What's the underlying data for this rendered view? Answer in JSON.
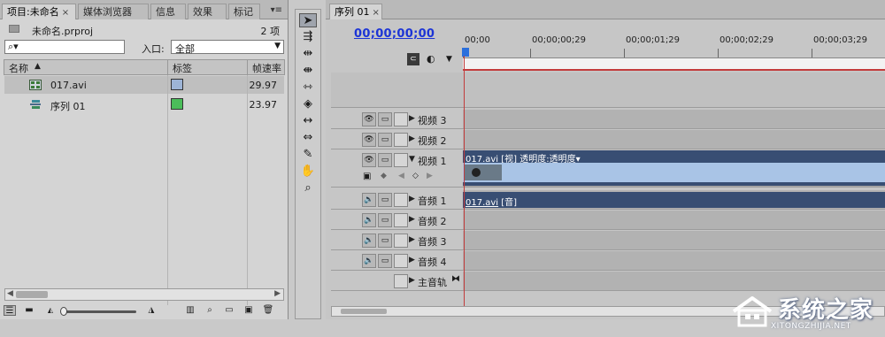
{
  "project_panel": {
    "tabs": [
      {
        "label": "项目:未命名",
        "close": "×"
      },
      {
        "label": "媒体浏览器"
      },
      {
        "label": "信息"
      },
      {
        "label": "效果"
      },
      {
        "label": "标记"
      }
    ],
    "menu_glyph": "▾≡",
    "project_file": "未命名.prproj",
    "item_count": "2 项",
    "search_placeholder": "",
    "search_glyph": "⌕▾",
    "entry_label": "入口:",
    "entry_value": "全部",
    "columns": {
      "name": "名称",
      "sort_glyph": "▲",
      "label": "标签",
      "fps": "帧速率"
    },
    "items": [
      {
        "name": "017.avi",
        "fps": "29.97",
        "swatch": "#9db4d6",
        "icon": "video-clip-icon"
      },
      {
        "name": "序列 01",
        "fps": "23.97",
        "swatch": "#4bbd5a",
        "icon": "sequence-icon"
      }
    ]
  },
  "tools": [
    "selection-tool",
    "track-select-tool",
    "ripple-edit-tool",
    "rolling-edit-tool",
    "rate-stretch-tool",
    "razor-tool",
    "slip-tool",
    "slide-tool",
    "pen-tool",
    "hand-tool",
    "zoom-tool"
  ],
  "timeline": {
    "tab_label": "序列 01",
    "tab_close": "×",
    "timecode": "00;00;00;00",
    "ruler_ticks": [
      "00;00",
      "00;00;00;29",
      "00;00;01;29",
      "00;00;02;29",
      "00;00;03;29"
    ],
    "video_tracks": [
      "视频 3",
      "视频 2",
      "视频 1"
    ],
    "audio_tracks": [
      "音频 1",
      "音频 2",
      "音频 3",
      "音频 4"
    ],
    "master_track": "主音轨",
    "video_clip": {
      "name": "017.avi",
      "tag": "[视]",
      "effect": "透明度:透明度▾"
    },
    "audio_clip": {
      "name": "017.avi",
      "tag": "[音]"
    }
  },
  "watermark": {
    "text": "系统之家",
    "url": "XITONGZHIJIA.NET"
  }
}
